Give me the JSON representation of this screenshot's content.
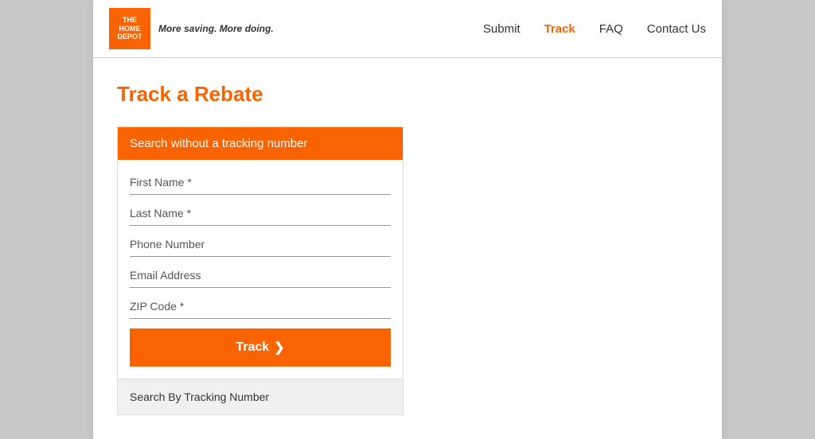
{
  "header": {
    "logo": {
      "line1": "THE",
      "line2": "HOME",
      "line3": "DEPOT",
      "tagline_prefix": "More saving. ",
      "tagline_bold": "More doing."
    },
    "nav": {
      "items": [
        {
          "label": "Submit",
          "active": false
        },
        {
          "label": "Track",
          "active": true
        },
        {
          "label": "FAQ",
          "active": false
        },
        {
          "label": "Contact Us",
          "active": false
        }
      ]
    }
  },
  "main": {
    "page_title": "Track a Rebate",
    "form": {
      "section_header": "Search without a tracking number",
      "fields": [
        {
          "placeholder": "First Name *"
        },
        {
          "placeholder": "Last Name *"
        },
        {
          "placeholder": "Phone Number"
        },
        {
          "placeholder": "Email Address"
        },
        {
          "placeholder": "ZIP Code *"
        }
      ],
      "track_button_label": "Track",
      "track_button_arrow": "❯",
      "footer_label": "Search By Tracking Number"
    }
  },
  "colors": {
    "orange": "#f96302",
    "white": "#ffffff",
    "gray_bg": "#c8c8c8",
    "border": "#dddddd"
  }
}
